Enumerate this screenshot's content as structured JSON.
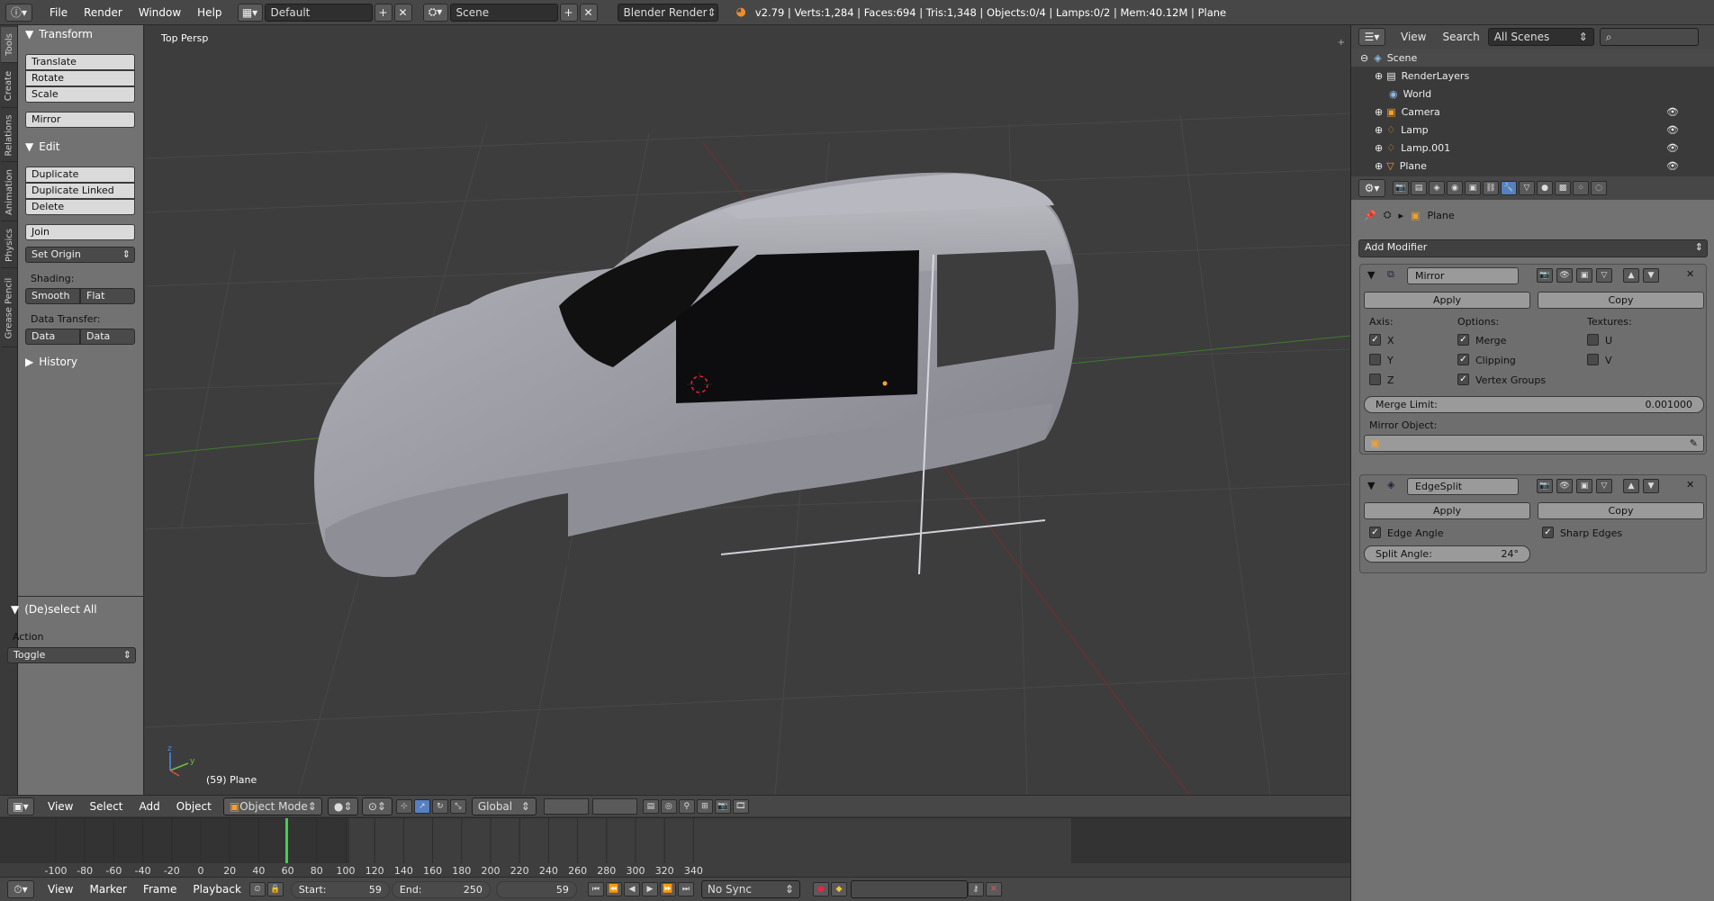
{
  "topbar": {
    "menus": [
      "File",
      "Render",
      "Window",
      "Help"
    ],
    "layout": "Default",
    "scene": "Scene",
    "engine": "Blender Render",
    "stats": "v2.79 | Verts:1,284 | Faces:694 | Tris:1,348 | Objects:0/4 | Lamps:0/2 | Mem:40.12M | Plane"
  },
  "tabs": [
    "Tools",
    "Create",
    "Relations",
    "Animation",
    "Physics",
    "Grease Pencil"
  ],
  "toolshelf": {
    "transform_title": "Transform",
    "translate": "Translate",
    "rotate": "Rotate",
    "scale": "Scale",
    "mirror": "Mirror",
    "edit_title": "Edit",
    "duplicate": "Duplicate",
    "duplicate_linked": "Duplicate Linked",
    "delete": "Delete",
    "join": "Join",
    "set_origin": "Set Origin",
    "shading_label": "Shading:",
    "smooth": "Smooth",
    "flat": "Flat",
    "data_transfer_label": "Data Transfer:",
    "data": "Data",
    "data_layout": "Data Layo",
    "history_title": "History",
    "deselect_title": "(De)select All",
    "action_label": "Action",
    "action_value": "Toggle"
  },
  "viewport": {
    "view_label": "Top Persp",
    "object_label": "(59) Plane"
  },
  "view3d_header": {
    "menus": [
      "View",
      "Select",
      "Add",
      "Object"
    ],
    "mode": "Object Mode",
    "orientation": "Global"
  },
  "timeline": {
    "ticks": [
      "-100",
      "-80",
      "-60",
      "-40",
      "-20",
      "0",
      "20",
      "40",
      "60",
      "80",
      "100",
      "120",
      "140",
      "160",
      "180",
      "200",
      "220",
      "240",
      "260",
      "280",
      "300",
      "320",
      "340"
    ],
    "current_frame": 59,
    "menus": [
      "View",
      "Marker",
      "Frame",
      "Playback"
    ],
    "start_label": "Start:",
    "start": "59",
    "end_label": "End:",
    "end": "250",
    "frame": "59",
    "sync": "No Sync"
  },
  "outliner": {
    "menus": [
      "View",
      "Search"
    ],
    "scope": "All Scenes",
    "rows": [
      "Scene",
      "RenderLayers",
      "World",
      "Camera",
      "Lamp",
      "Lamp.001",
      "Plane"
    ]
  },
  "properties": {
    "object_name": "Plane",
    "add_modifier": "Add Modifier",
    "mirror": {
      "name": "Mirror",
      "apply": "Apply",
      "copy": "Copy",
      "axis_label": "Axis:",
      "options_label": "Options:",
      "textures_label": "Textures:",
      "x": "X",
      "y": "Y",
      "z": "Z",
      "merge": "Merge",
      "clipping": "Clipping",
      "vertex_groups": "Vertex Groups",
      "u": "U",
      "v": "V",
      "merge_limit_label": "Merge Limit:",
      "merge_limit_value": "0.001000",
      "mirror_object_label": "Mirror Object:"
    },
    "edgesplit": {
      "name": "EdgeSplit",
      "apply": "Apply",
      "copy": "Copy",
      "edge_angle": "Edge Angle",
      "sharp_edges": "Sharp Edges",
      "split_angle_label": "Split Angle:",
      "split_angle_value": "24°"
    }
  }
}
